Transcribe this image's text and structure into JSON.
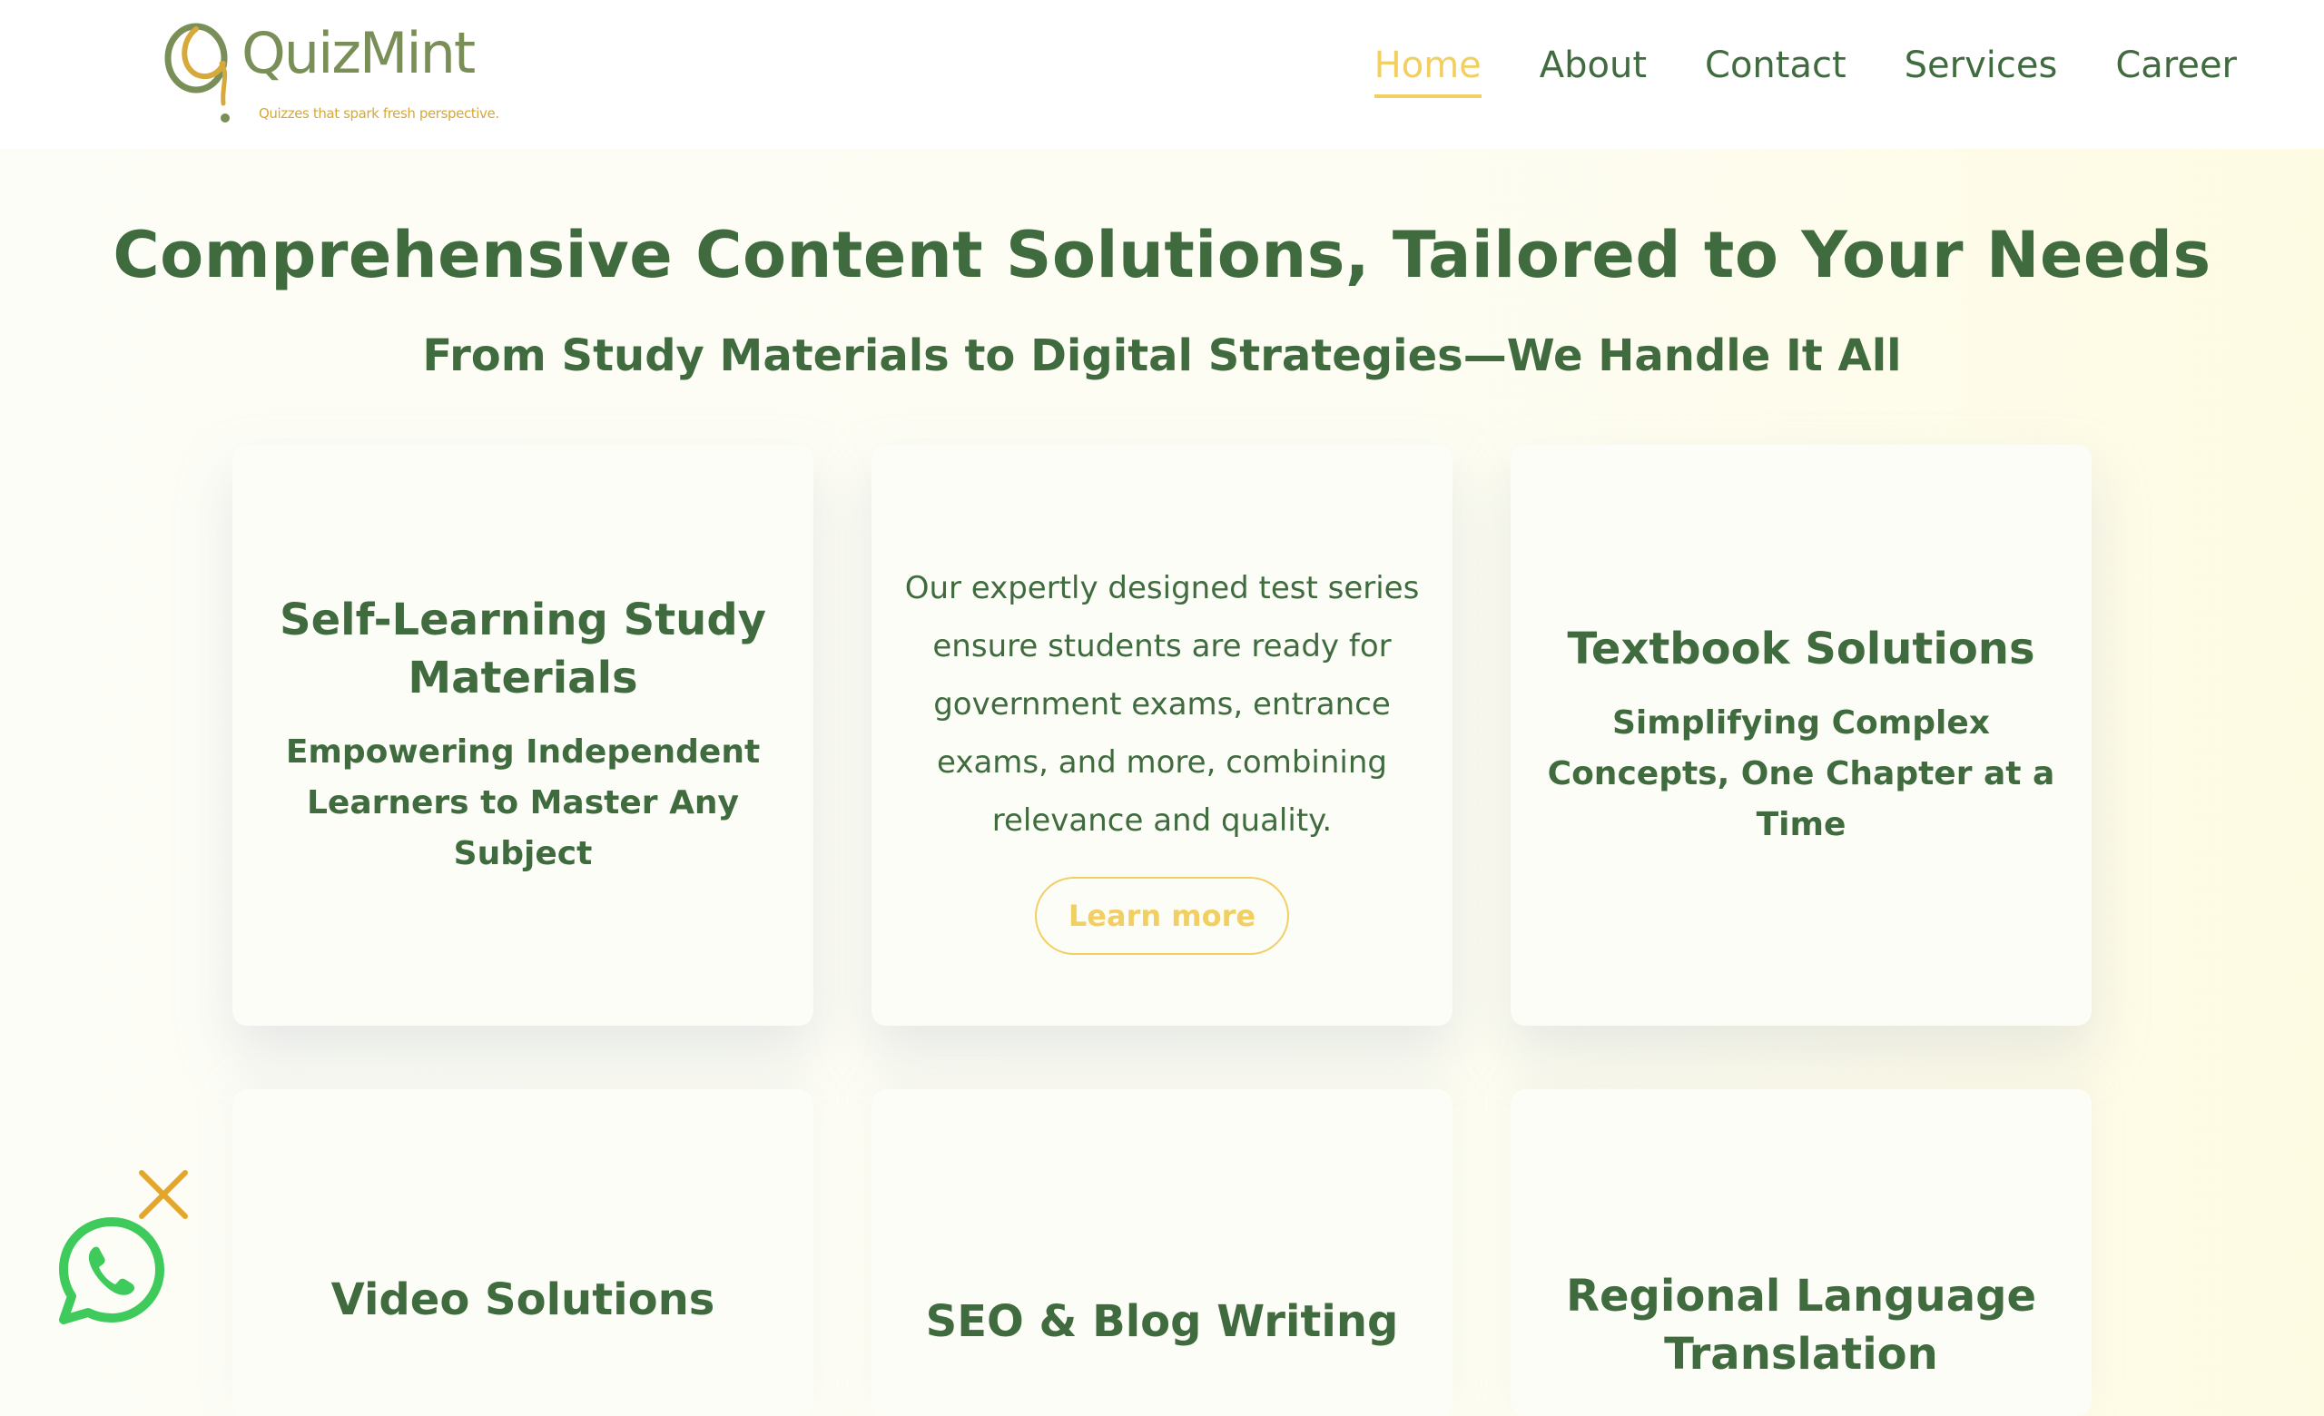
{
  "brand": {
    "name": "QuizMint",
    "tagline": "Quizzes that spark fresh perspective."
  },
  "nav": {
    "items": [
      {
        "label": "Home",
        "active": true
      },
      {
        "label": "About",
        "active": false
      },
      {
        "label": "Contact",
        "active": false
      },
      {
        "label": "Services",
        "active": false
      },
      {
        "label": "Career",
        "active": false
      }
    ]
  },
  "hero": {
    "title": "Comprehensive Content Solutions, Tailored to Your Needs",
    "subtitle": "From Study Materials to Digital Strategies—We Handle It All"
  },
  "cards": {
    "self_learning": {
      "title": "Self-Learning Study Materials",
      "subtitle": "Empowering Independent Learners to Master Any Subject"
    },
    "test_series": {
      "body": "Our expertly designed test series ensure students are ready for government exams, entrance exams, and more, combining relevance and quality.",
      "button": "Learn more"
    },
    "textbook": {
      "title": "Textbook Solutions",
      "subtitle": "Simplifying Complex Concepts, One Chapter at a Time"
    },
    "video": {
      "title": "Video Solutions"
    },
    "seo": {
      "title": "SEO & Blog Writing"
    },
    "regional": {
      "title": "Regional Language Translation"
    }
  },
  "widgets": {
    "whatsapp_icon": "whatsapp-icon",
    "close_icon": "close-icon"
  },
  "colors": {
    "primary": "#3f6b3f",
    "accent": "#f2cf63",
    "whatsapp": "#3ecb5c",
    "close": "#e3a52a"
  }
}
